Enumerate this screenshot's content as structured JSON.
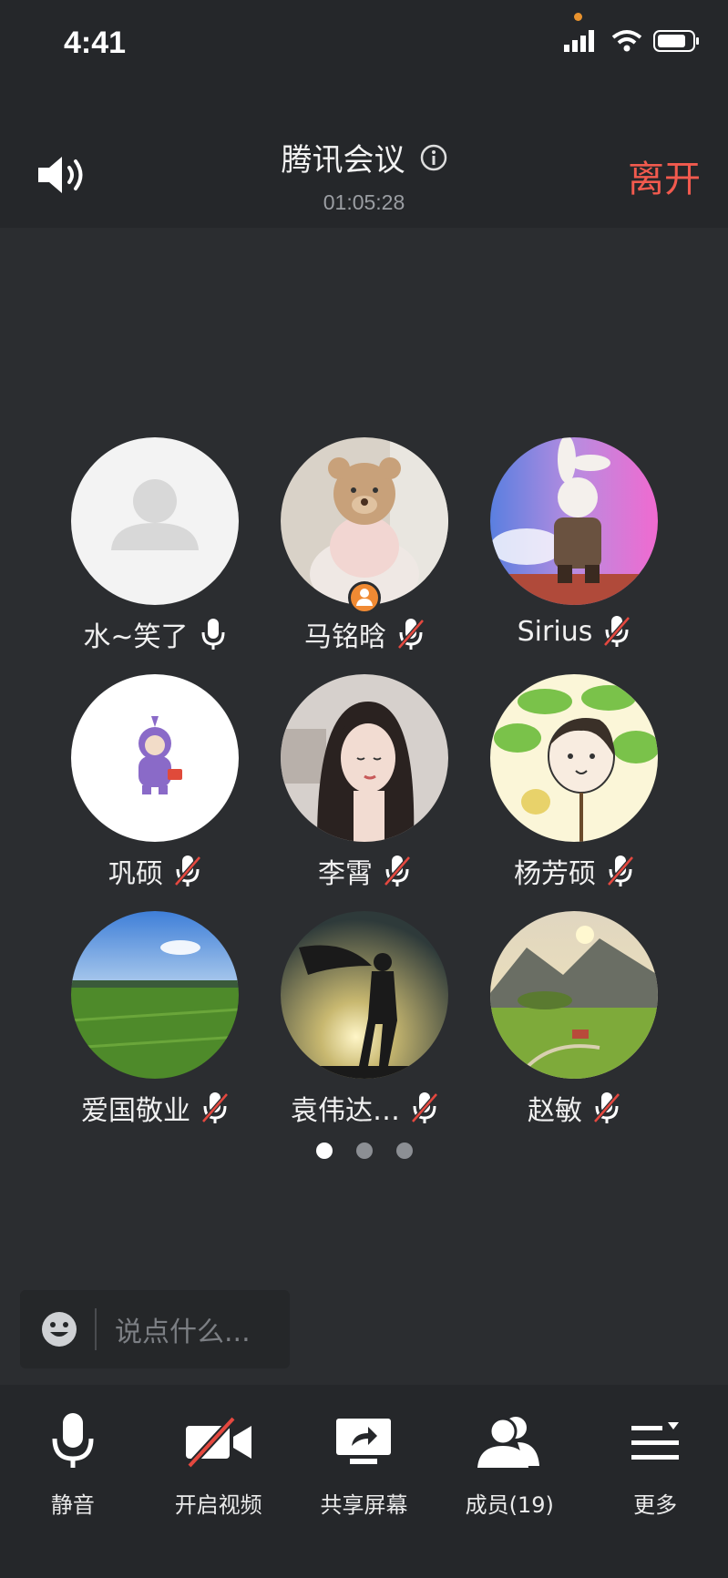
{
  "status_bar": {
    "time": "4:41"
  },
  "header": {
    "title": "腾讯会议",
    "timer": "01:05:28",
    "leave_label": "离开"
  },
  "participants": [
    {
      "name": "水~笑了",
      "mic": "on",
      "avatar": "default-avatar"
    },
    {
      "name": "马铭晗",
      "mic": "off",
      "avatar": "teddy-bear-photo",
      "host": true
    },
    {
      "name": "Sirius",
      "mic": "off",
      "avatar": "rabbit-soldier-image"
    },
    {
      "name": "巩硕",
      "mic": "off",
      "avatar": "purple-teletubby-image"
    },
    {
      "name": "李霄",
      "mic": "off",
      "avatar": "woman-portrait-photo"
    },
    {
      "name": "杨芳硕",
      "mic": "off",
      "avatar": "cartoon-girl-drawing"
    },
    {
      "name": "爱国敬业",
      "mic": "off",
      "avatar": "green-field-photo"
    },
    {
      "name": "袁伟达…",
      "mic": "off",
      "avatar": "caped-figure-sunset-photo"
    },
    {
      "name": "赵敏",
      "mic": "off",
      "avatar": "mountain-village-photo"
    }
  ],
  "pager": {
    "pages": 3,
    "current": 1
  },
  "chat": {
    "placeholder": "说点什么..."
  },
  "toolbar": {
    "mute": "静音",
    "video": "开启视频",
    "share": "共享屏幕",
    "members": "成员(19)",
    "more": "更多"
  },
  "colors": {
    "leave": "#f25a4e",
    "host_badge": "#f08a33",
    "mic_muted": "#e5483f"
  }
}
